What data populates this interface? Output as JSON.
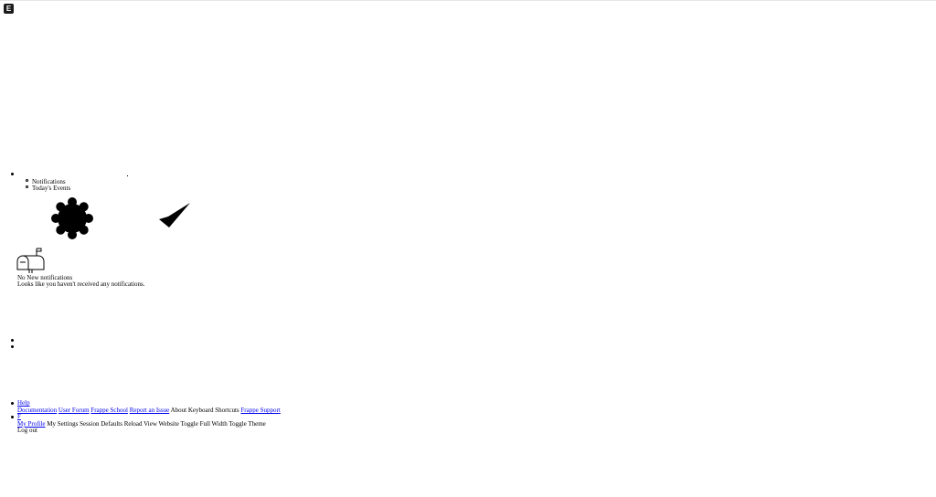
{
  "app": {
    "logo_letter": "E"
  },
  "notifications_panel": {
    "tabs": [
      "Notifications",
      "Today's Events"
    ],
    "empty_title": "No New notifications",
    "empty_subtitle": "Looks like you haven't received any notifications."
  },
  "help_menu": {
    "label": "Help",
    "items": [
      "Documentation",
      "User Forum",
      "Frappe School",
      "Report an Issue",
      "About",
      "Keyboard Shortcuts",
      "Frappe Support"
    ]
  },
  "user_menu": {
    "avatar_initial": "F",
    "items": [
      "My Profile",
      "My Settings",
      "Session Defaults",
      "Reload",
      "View Website",
      "Toggle Full Width",
      "Toggle Theme"
    ],
    "logout_label": "Log out"
  },
  "icons": [
    "logo-icon",
    "gear-icon",
    "checkmark-icon",
    "mailbox-icon"
  ]
}
